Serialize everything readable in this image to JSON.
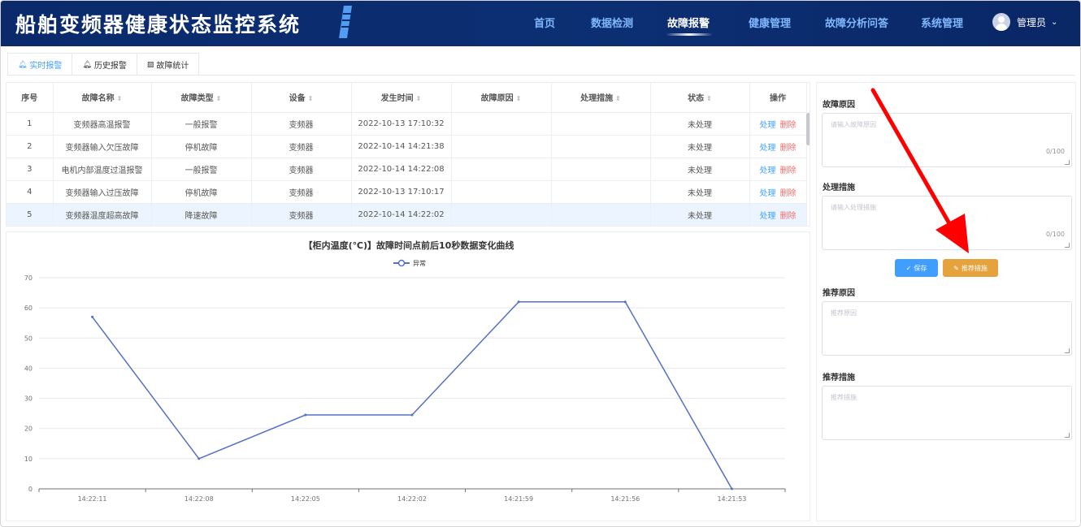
{
  "header": {
    "title": "船舶变频器健康状态监控系统",
    "nav": [
      {
        "label": "首页",
        "active": false
      },
      {
        "label": "数据检测",
        "active": false
      },
      {
        "label": "故障报警",
        "active": true
      },
      {
        "label": "健康管理",
        "active": false
      },
      {
        "label": "故障分析问答",
        "active": false
      },
      {
        "label": "系统管理",
        "active": false
      }
    ],
    "user": {
      "name": "管理员",
      "icon": "avatar-icon",
      "chevron": "chevron-down-icon"
    }
  },
  "tabs": [
    {
      "label": "实时报警",
      "icon": "bell-icon",
      "active": true
    },
    {
      "label": "历史报警",
      "icon": "bell-icon",
      "active": false
    },
    {
      "label": "故障统计",
      "icon": "chart-icon",
      "active": false
    }
  ],
  "table": {
    "columns": [
      "序号",
      "故障名称",
      "故障类型",
      "设备",
      "发生时间",
      "故障原因",
      "处理措施",
      "状态",
      "操作"
    ],
    "rows": [
      {
        "index": "1",
        "name": "变频器高温报警",
        "type": "一般报警",
        "device": "变频器",
        "time": "2022-10-13 17:10:32",
        "cause": "",
        "measure": "",
        "status": "未处理"
      },
      {
        "index": "2",
        "name": "变频器输入欠压故障",
        "type": "停机故障",
        "device": "变频器",
        "time": "2022-10-14 14:21:38",
        "cause": "",
        "measure": "",
        "status": "未处理"
      },
      {
        "index": "3",
        "name": "电机内部温度过温报警",
        "type": "一般报警",
        "device": "变频器",
        "time": "2022-10-14 14:22:08",
        "cause": "",
        "measure": "",
        "status": "未处理"
      },
      {
        "index": "4",
        "name": "变频器输入过压故障",
        "type": "停机故障",
        "device": "变频器",
        "time": "2022-10-13 17:10:17",
        "cause": "",
        "measure": "",
        "status": "未处理"
      },
      {
        "index": "5",
        "name": "变频器温度超高故障",
        "type": "降速故障",
        "device": "变频器",
        "time": "2022-10-14 14:22:02",
        "cause": "",
        "measure": "",
        "status": "未处理"
      }
    ],
    "actions": {
      "handle": "处理",
      "delete": "删除"
    },
    "selected_row": 5
  },
  "chart_data": {
    "type": "line",
    "title": "【柜内温度(℃)】故障时间点前后10秒数据变化曲线",
    "categories": [
      "14:22:11",
      "14:22:08",
      "14:22:05",
      "14:22:02",
      "14:21:59",
      "14:21:56",
      "14:21:53"
    ],
    "series": [
      {
        "name": "异常",
        "values": [
          57,
          10,
          24.5,
          24.5,
          62,
          62,
          0
        ],
        "color": "#5470c6"
      }
    ],
    "ylim": [
      0,
      70
    ],
    "yticks": [
      0,
      10,
      20,
      30,
      40,
      50,
      60,
      70
    ],
    "grid": true,
    "legend": "top-center"
  },
  "form": {
    "cause_label": "故障原因",
    "cause_placeholder": "请输入故障原因",
    "cause_count": "0/100",
    "measure_label": "处理措施",
    "measure_placeholder": "请输入处理措施",
    "measure_count": "0/100",
    "save_label": "保存",
    "recommend_label": "推荐措施",
    "rec_cause_label": "推荐原因",
    "rec_cause_placeholder": "推荐原因",
    "rec_measure_label": "推荐措施",
    "rec_measure_placeholder": "推荐措施"
  },
  "colors": {
    "header_bg": "#0c2f73",
    "nav_text": "#7fb8ff",
    "primary": "#409eff",
    "danger": "#f56c6c",
    "warning": "#e6a23c",
    "annotation_arrow": "#ff0000"
  }
}
